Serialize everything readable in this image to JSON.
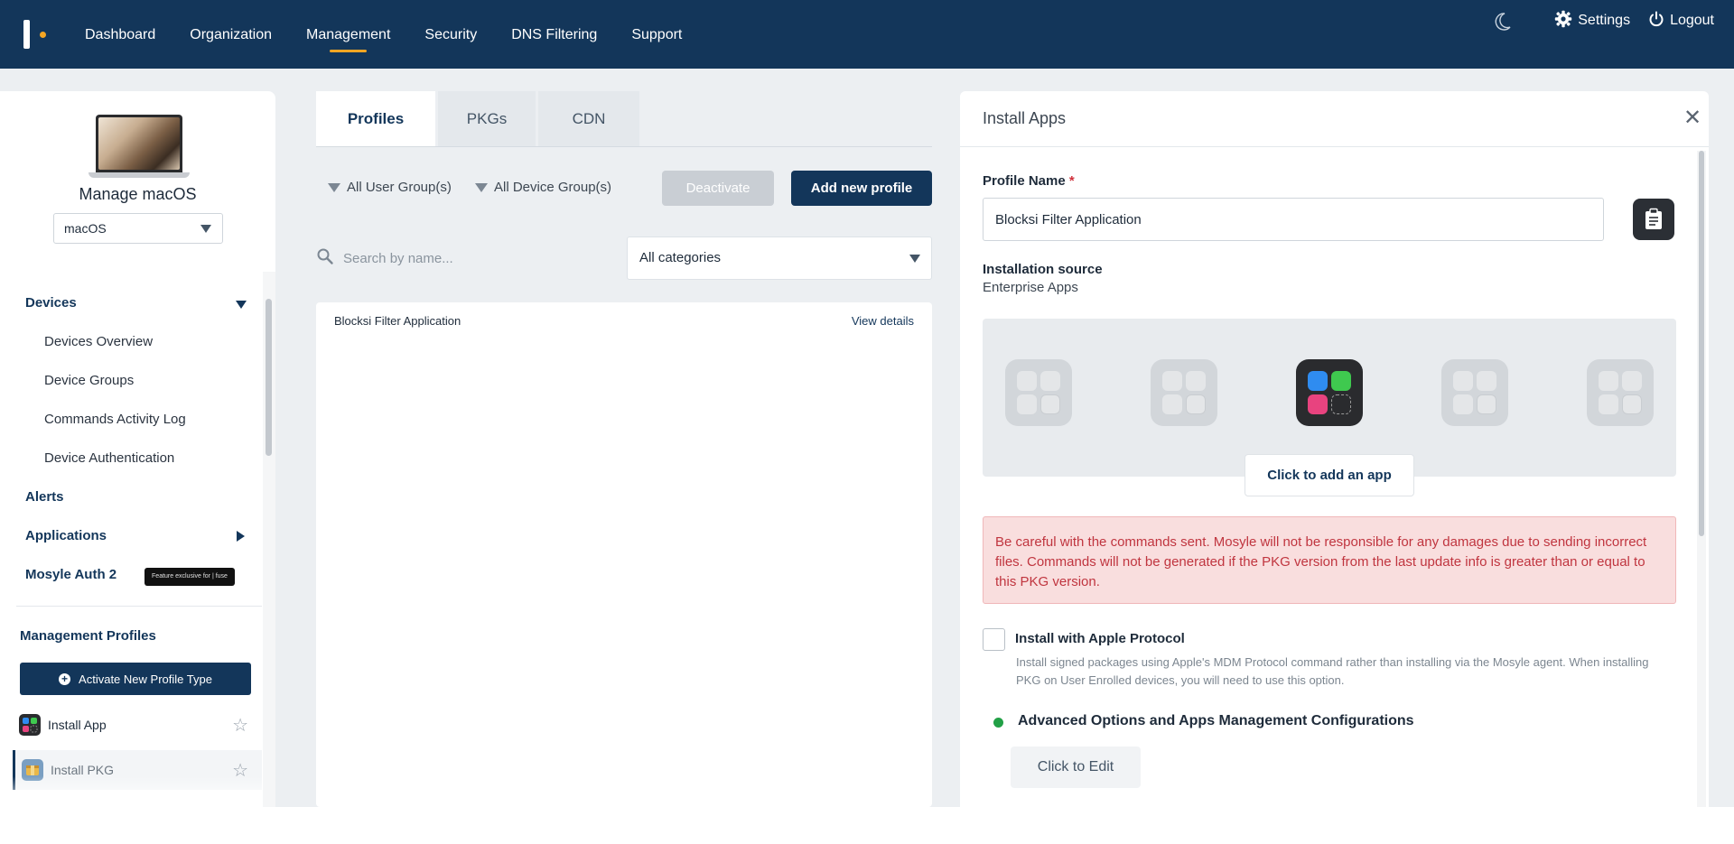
{
  "nav": {
    "items": [
      "Dashboard",
      "Organization",
      "Management",
      "Security",
      "DNS Filtering",
      "Support"
    ],
    "active": "Management",
    "settings_label": "Settings",
    "logout_label": "Logout"
  },
  "sidebar": {
    "title": "Manage macOS",
    "os_select": "macOS",
    "devices_label": "Devices",
    "device_items": [
      "Devices Overview",
      "Device Groups",
      "Commands Activity Log",
      "Device Authentication"
    ],
    "alerts_label": "Alerts",
    "applications_label": "Applications",
    "auth_label": "Mosyle Auth 2",
    "fuse_badge": "Feature exclusive for | fuse",
    "mgmt_profiles_title": "Management Profiles",
    "activate_label": "Activate New Profile Type",
    "profiles": [
      {
        "label": "Install App"
      },
      {
        "label": "Install PKG"
      }
    ]
  },
  "middle": {
    "tabs": [
      "Profiles",
      "PKGs",
      "CDN"
    ],
    "active_tab": "Profiles",
    "filter_user": "All User Group(s)",
    "filter_device": "All Device Group(s)",
    "deactivate_label": "Deactivate",
    "add_label": "Add new profile",
    "search_placeholder": "Search by name...",
    "category_select": "All categories",
    "rows": [
      {
        "name": "Blocksi Filter Application",
        "action": "View details"
      }
    ]
  },
  "panel": {
    "title": "Install Apps",
    "profile_name_label": "Profile Name",
    "required_mark": "*",
    "profile_name_value": "Blocksi Filter Application",
    "installation_source_label": "Installation source",
    "installation_source_value": "Enterprise Apps",
    "add_app_label": "Click to add an app",
    "warning": "Be careful with the commands sent. Mosyle will not be responsible for any damages due to sending incorrect files. Commands will not be generated if the PKG version from the last update info is greater than or equal to this PKG version.",
    "apple_protocol_label": "Install with Apple Protocol",
    "apple_protocol_help": "Install signed packages using Apple's MDM Protocol command rather than installing via the Mosyle agent. When installing PKG on User Enrolled devices, you will need to use this option.",
    "advanced_title": "Advanced Options and Apps Management Configurations",
    "edit_label": "Click to Edit"
  },
  "colors": {
    "brand": "#13365a",
    "accent": "#f5a623",
    "warning_bg": "#f9dede",
    "warning_text": "#c0353f",
    "status_green": "#22a046"
  }
}
